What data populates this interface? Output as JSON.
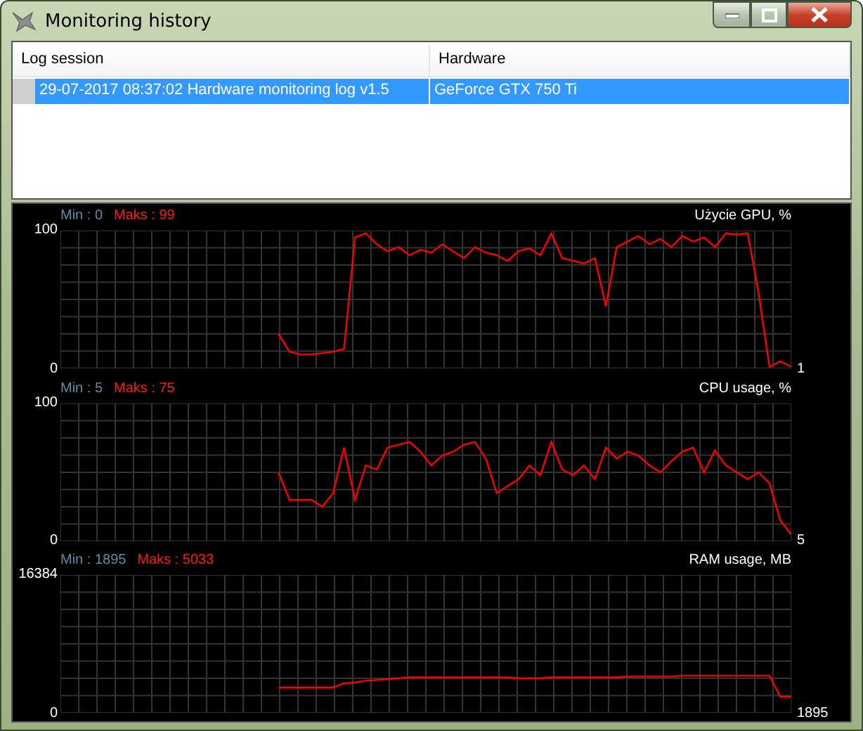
{
  "window": {
    "title": "Monitoring history"
  },
  "table": {
    "columns": [
      "Log session",
      "Hardware"
    ],
    "rows": [
      {
        "cells": [
          "29-07-2017 08:37:02 Hardware monitoring log v1.5",
          "GeForce GTX 750 Ti"
        ],
        "selected": true
      }
    ]
  },
  "graphs": [
    {
      "min_label": "Min : 0",
      "max_label": "Maks : 99",
      "current_value": "1",
      "chart_data": {
        "type": "line",
        "title": "Użycie GPU, %",
        "grid": true,
        "ylim": [
          0,
          100
        ],
        "yticks": [
          0,
          100
        ],
        "series": [
          {
            "color": "#ff0000",
            "values": [
              null,
              null,
              null,
              null,
              null,
              null,
              null,
              null,
              null,
              null,
              null,
              null,
              null,
              null,
              null,
              null,
              null,
              null,
              null,
              null,
              25,
              12,
              10,
              10,
              11,
              12,
              14,
              95,
              98,
              90,
              85,
              88,
              82,
              86,
              84,
              90,
              85,
              80,
              88,
              84,
              82,
              78,
              85,
              87,
              82,
              98,
              80,
              78,
              76,
              80,
              45,
              88,
              92,
              96,
              90,
              94,
              88,
              96,
              92,
              95,
              88,
              98,
              97,
              98,
              55,
              1,
              5,
              1
            ]
          }
        ]
      }
    },
    {
      "min_label": "Min : 5",
      "max_label": "Maks : 75",
      "current_value": "5",
      "chart_data": {
        "type": "line",
        "title": "CPU usage, %",
        "grid": true,
        "ylim": [
          0,
          100
        ],
        "yticks": [
          0,
          100
        ],
        "series": [
          {
            "color": "#ff0000",
            "values": [
              null,
              null,
              null,
              null,
              null,
              null,
              null,
              null,
              null,
              null,
              null,
              null,
              null,
              null,
              null,
              null,
              null,
              null,
              null,
              null,
              50,
              30,
              30,
              30,
              25,
              35,
              68,
              30,
              55,
              52,
              68,
              70,
              72,
              65,
              55,
              62,
              65,
              70,
              72,
              60,
              35,
              40,
              45,
              55,
              48,
              72,
              52,
              48,
              55,
              45,
              68,
              60,
              65,
              62,
              55,
              50,
              58,
              65,
              68,
              50,
              66,
              55,
              50,
              45,
              50,
              42,
              15,
              5
            ]
          }
        ]
      }
    },
    {
      "min_label": "Min : 1895",
      "max_label": "Maks : 5033",
      "current_value": "1895",
      "chart_data": {
        "type": "line",
        "title": "RAM usage, MB",
        "grid": true,
        "ylim": [
          0,
          16384
        ],
        "yticks": [
          0,
          16384
        ],
        "series": [
          {
            "color": "#ff0000",
            "values": [
              null,
              null,
              null,
              null,
              null,
              null,
              null,
              null,
              null,
              null,
              null,
              null,
              null,
              null,
              null,
              null,
              null,
              null,
              null,
              null,
              3000,
              3000,
              3000,
              3000,
              3000,
              3000,
              3500,
              3600,
              3800,
              3900,
              4000,
              4100,
              4200,
              4200,
              4200,
              4200,
              4200,
              4200,
              4200,
              4200,
              4200,
              4200,
              4100,
              4100,
              4100,
              4200,
              4200,
              4200,
              4200,
              4200,
              4200,
              4200,
              4300,
              4300,
              4300,
              4300,
              4300,
              4400,
              4400,
              4400,
              4400,
              4400,
              4400,
              4400,
              4400,
              4400,
              1900,
              1900
            ]
          }
        ]
      }
    }
  ]
}
